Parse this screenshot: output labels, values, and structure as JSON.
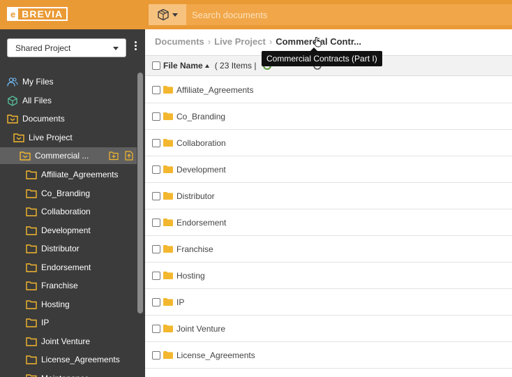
{
  "header": {
    "logo_prefix": "e",
    "logo_text": "BREVIA",
    "search_placeholder": "Search documents"
  },
  "sidebar": {
    "project_select": "Shared Project",
    "items": [
      {
        "label": "My Files",
        "icon": "users-icon"
      },
      {
        "label": "All Files",
        "icon": "cube-icon"
      },
      {
        "label": "Documents",
        "icon": "folder-open-icon"
      },
      {
        "label": "Live Project",
        "icon": "folder-open-icon"
      },
      {
        "label": "Commercial ...",
        "icon": "folder-open-icon"
      },
      {
        "label": "Affiliate_Agreements",
        "icon": "folder-icon"
      },
      {
        "label": "Co_Branding",
        "icon": "folder-icon"
      },
      {
        "label": "Collaboration",
        "icon": "folder-icon"
      },
      {
        "label": "Development",
        "icon": "folder-icon"
      },
      {
        "label": "Distributor",
        "icon": "folder-icon"
      },
      {
        "label": "Endorsement",
        "icon": "folder-icon"
      },
      {
        "label": "Franchise",
        "icon": "folder-icon"
      },
      {
        "label": "Hosting",
        "icon": "folder-icon"
      },
      {
        "label": "IP",
        "icon": "folder-icon"
      },
      {
        "label": "Joint Venture",
        "icon": "folder-icon"
      },
      {
        "label": "License_Agreements",
        "icon": "folder-icon"
      },
      {
        "label": "Maintenance",
        "icon": "folder-icon"
      }
    ]
  },
  "breadcrumb": {
    "items": [
      "Documents",
      "Live Project",
      "Commercial Contr..."
    ]
  },
  "tooltip": "Commercial Contracts (Part I)",
  "table": {
    "col_file_name": "File Name",
    "item_count": "( 23 Items |",
    "rows": [
      "Affiliate_Agreements",
      "Co_Branding",
      "Collaboration",
      "Development",
      "Distributor",
      "Endorsement",
      "Franchise",
      "Hosting",
      "IP",
      "Joint Venture",
      "License_Agreements"
    ]
  },
  "colors": {
    "accent": "#ea9a35",
    "folder": "#f3b72f",
    "sidebar_bg": "#3b3b3b"
  }
}
